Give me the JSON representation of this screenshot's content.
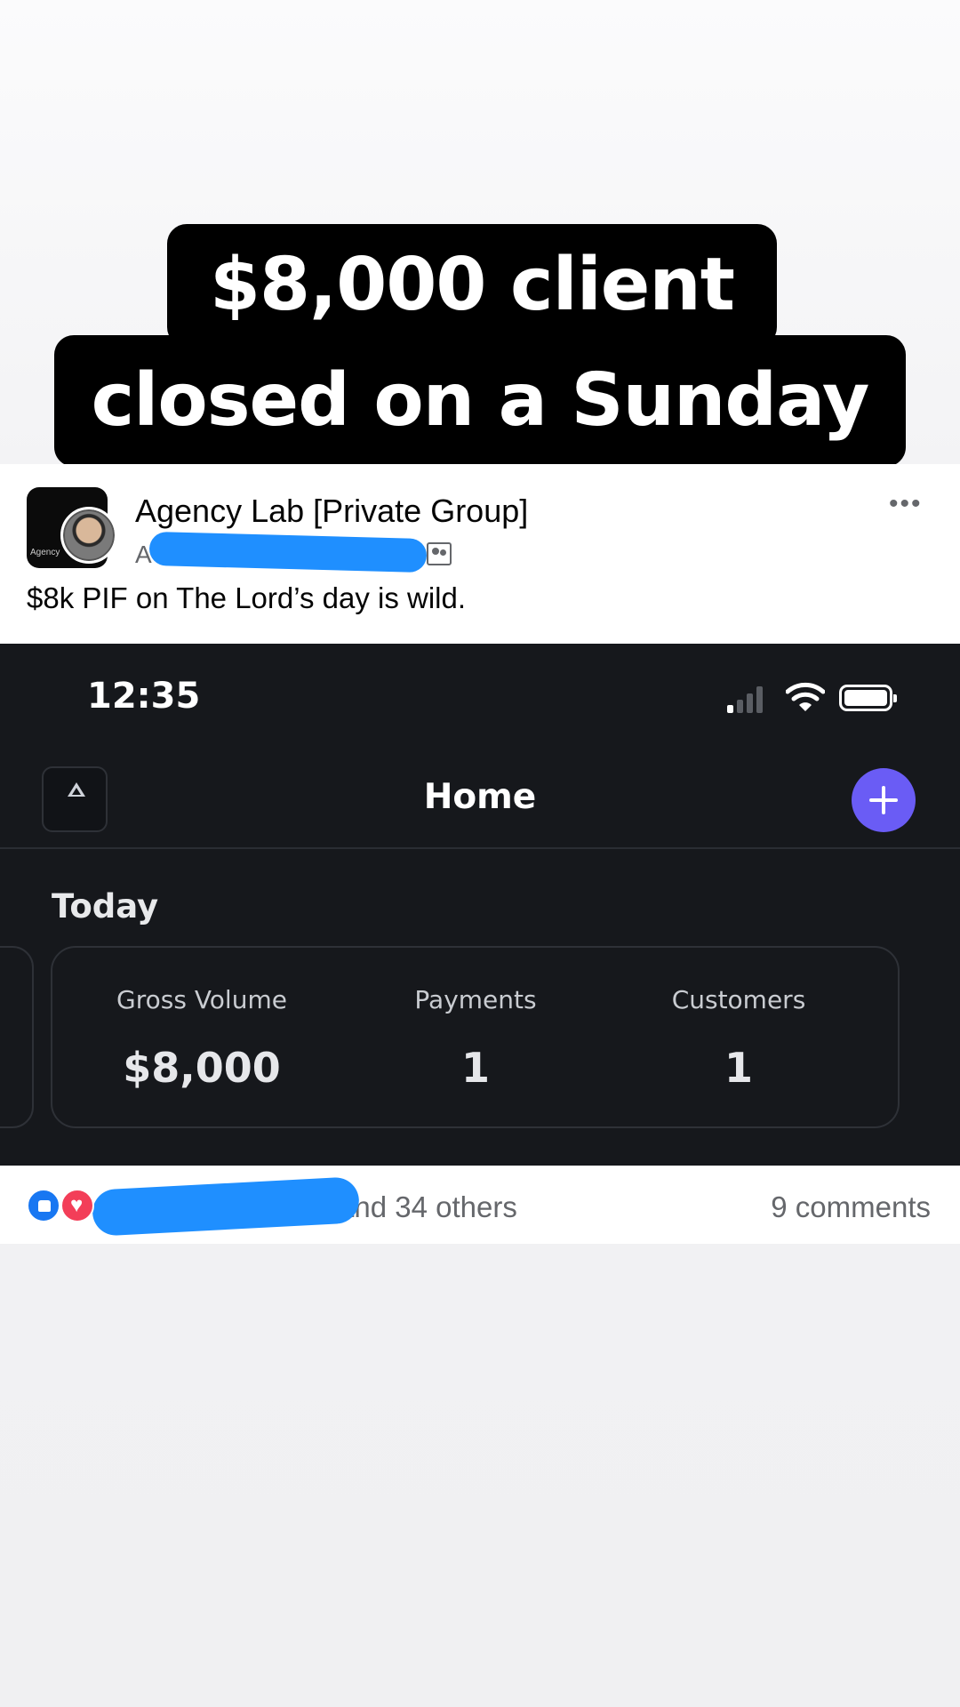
{
  "caption": {
    "line1": "$8,000 client",
    "line2": "closed on a Sunday"
  },
  "post": {
    "group_name": "Agency Lab [Private Group]",
    "author_initial": "A",
    "group_avatar_text": "Agency",
    "text": "$8k PIF on The Lord’s day is wild.",
    "more_icon": "more-options-icon"
  },
  "screenshot": {
    "status_bar": {
      "time": "12:35"
    },
    "nav": {
      "title": "Home"
    },
    "section_title": "Today",
    "stats": [
      {
        "label": "Gross Volume",
        "value": "$8,000"
      },
      {
        "label": "Payments",
        "value": "1"
      },
      {
        "label": "Customers",
        "value": "1"
      }
    ],
    "colors": {
      "background": "#16181c",
      "accent": "#6a5cf5"
    }
  },
  "reactions": {
    "others": "and 34 others",
    "comments": "9 comments"
  },
  "colors": {
    "redaction": "#1f8fff",
    "like": "#1877f2",
    "love": "#f33e58"
  }
}
